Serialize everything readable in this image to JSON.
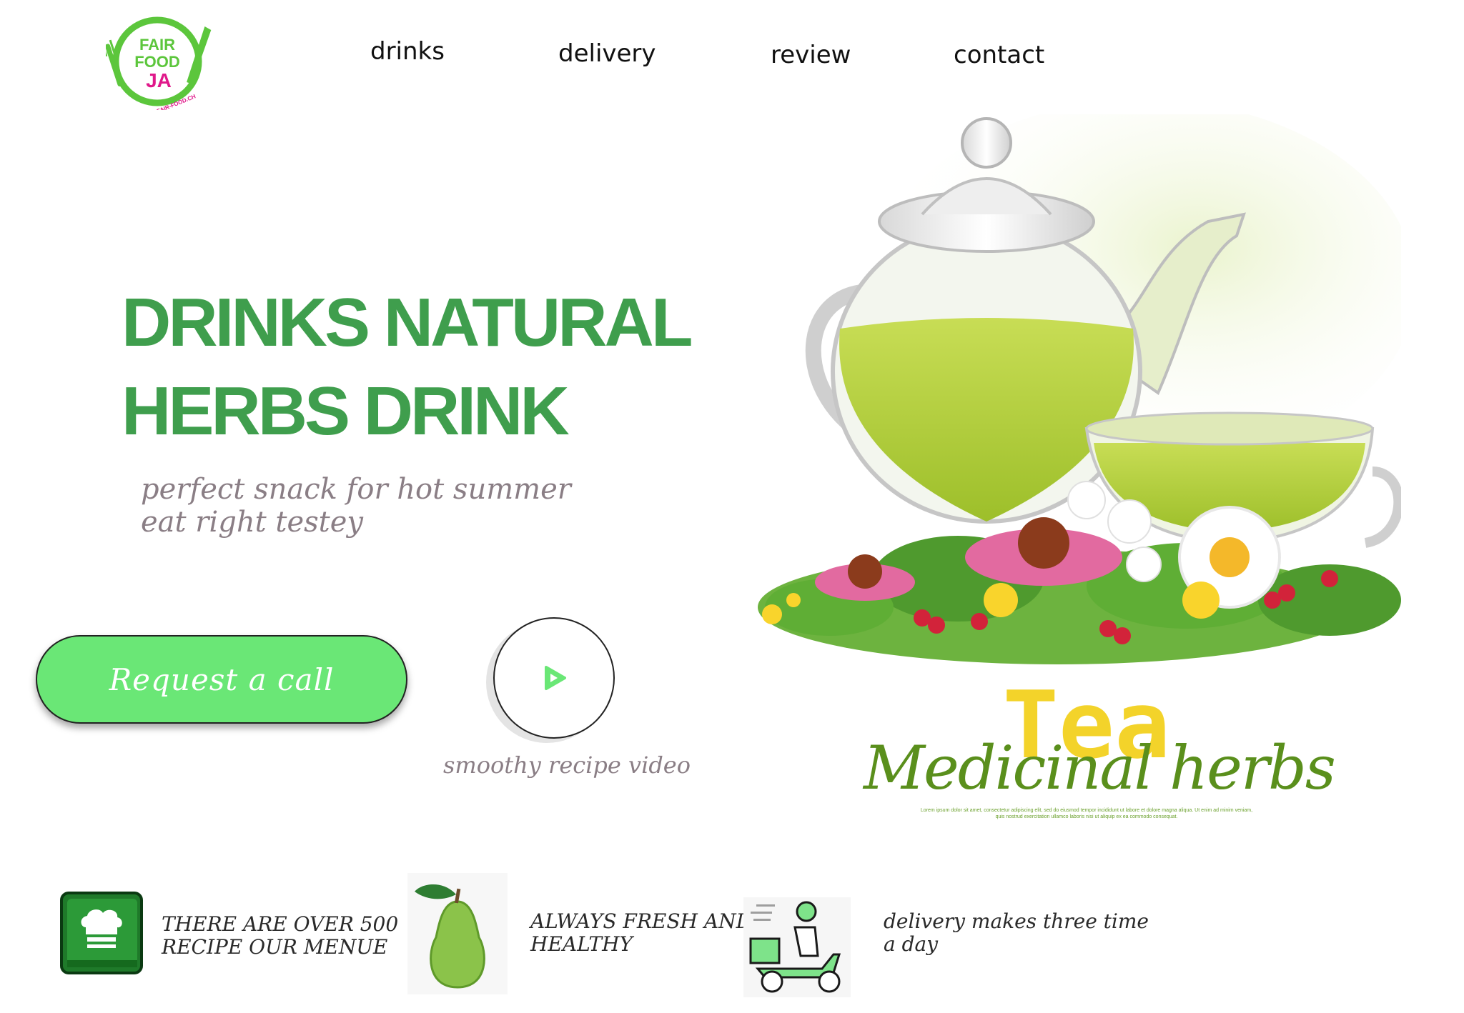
{
  "brand": {
    "logo_line1": "FAIR",
    "logo_line2": "FOOD",
    "logo_line3": "JA",
    "logo_url_text": "FAIR-FOOD.CH",
    "logo_green": "#5cc63c",
    "logo_magenta": "#e0188a"
  },
  "nav": {
    "items": [
      {
        "label": "drinks"
      },
      {
        "label": "delivery"
      },
      {
        "label": "review"
      },
      {
        "label": "contact"
      }
    ]
  },
  "hero": {
    "title_line1": "DRINKS NATURAL",
    "title_line2": "HERBS DRINK",
    "subtitle_line1": "perfect snack for hot summer",
    "subtitle_line2": "eat right testey",
    "cta_label": "Request a call",
    "video_label": "smoothy recipe video",
    "accent_color": "#3f9e4d",
    "cta_color": "#6ae776"
  },
  "illustration": {
    "tea_word": "Tea",
    "herbs_word": "Medicinal herbs",
    "fine_print_line1": "Lorem ipsum dolor sit amet, consectetur adipiscing elit, sed do eiusmod tempor incididunt ut labore et dolore magna aliqua. Ut enim ad minim veniam,",
    "fine_print_line2": "quis nostrud exercitation ullamco laboris nisi ut aliquip ex ea commodo consequat."
  },
  "features": [
    {
      "icon": "recipe-book-icon",
      "line1": "THERE ARE OVER 500",
      "line2": "RECIPE OUR  MENUE"
    },
    {
      "icon": "pear-icon",
      "line1": "ALWAYS FRESH AND",
      "line2": "HEALTHY"
    },
    {
      "icon": "delivery-scooter-icon",
      "line1": "delivery makes three time",
      "line2": "a day"
    }
  ]
}
